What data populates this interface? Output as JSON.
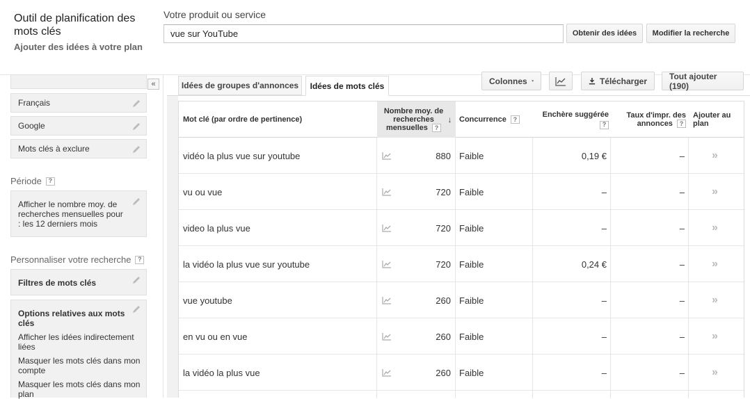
{
  "header": {
    "title": "Outil de planification des mots clés",
    "subtitle": "Ajouter des idées à votre plan",
    "product_label": "Votre produit ou service",
    "product_value": "vue sur YouTube",
    "get_ideas_label": "Obtenir des idées",
    "modify_search_label": "Modifier la recherche"
  },
  "sidebar": {
    "collapse_glyph": "«",
    "language": "Français",
    "network": "Google",
    "negative_keywords": "Mots clés à exclure",
    "period_label": "Période",
    "period_text": "Afficher le nombre moy. de recherches mensuelles pour : les 12 derniers mois",
    "customize_label": "Personnaliser votre recherche",
    "keyword_filters": "Filtres de mots clés",
    "keyword_options_title": "Options relatives aux mots clés",
    "option_1": "Afficher les idées indirectement liées",
    "option_2": "Masquer les mots clés dans mon compte",
    "option_3": "Masquer les mots clés dans mon plan",
    "help_glyph": "?"
  },
  "tabs": {
    "ad_groups": "Idées de groupes d'annonces",
    "keywords": "Idées de mots clés"
  },
  "toolbar": {
    "columns": "Colonnes",
    "download": "Télécharger",
    "add_all": "Tout ajouter (190)"
  },
  "table": {
    "headers": {
      "keyword": "Mot clé (par ordre de pertinence)",
      "avg_searches": "Nombre moy. de recherches mensuelles",
      "competition": "Concurrence",
      "suggested_bid": "Enchère suggérée",
      "impression_share": "Taux d'impr. des annonces",
      "add_to_plan": "Ajouter au plan"
    },
    "rows": [
      {
        "keyword": "vidéo la plus vue sur youtube",
        "searches": "880",
        "competition": "Faible",
        "bid": "0,19 €",
        "share": "–"
      },
      {
        "keyword": "vu ou vue",
        "searches": "720",
        "competition": "Faible",
        "bid": "–",
        "share": "–"
      },
      {
        "keyword": "video la plus vue",
        "searches": "720",
        "competition": "Faible",
        "bid": "–",
        "share": "–"
      },
      {
        "keyword": "la vidéo la plus vue sur youtube",
        "searches": "720",
        "competition": "Faible",
        "bid": "0,24 €",
        "share": "–"
      },
      {
        "keyword": "vue youtube",
        "searches": "260",
        "competition": "Faible",
        "bid": "–",
        "share": "–"
      },
      {
        "keyword": "en vu ou en vue",
        "searches": "260",
        "competition": "Faible",
        "bid": "–",
        "share": "–"
      },
      {
        "keyword": "la vidéo la plus vue",
        "searches": "260",
        "competition": "Faible",
        "bid": "–",
        "share": "–"
      }
    ],
    "add_glyph": "»",
    "sort_glyph": "↓"
  }
}
